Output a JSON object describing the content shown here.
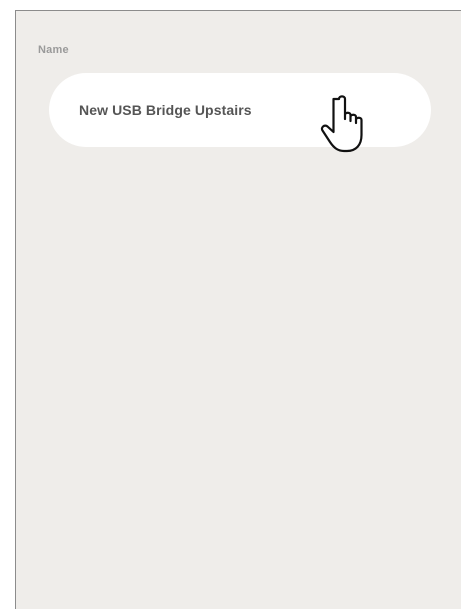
{
  "form": {
    "name_label": "Name",
    "name_value": "New USB Bridge Upstairs"
  },
  "cursor": {
    "icon": "hand-pointer-icon"
  },
  "colors": {
    "panel_background": "#efedea",
    "field_background": "#ffffff",
    "label_text": "#9a9a9a",
    "value_text": "#555555"
  }
}
